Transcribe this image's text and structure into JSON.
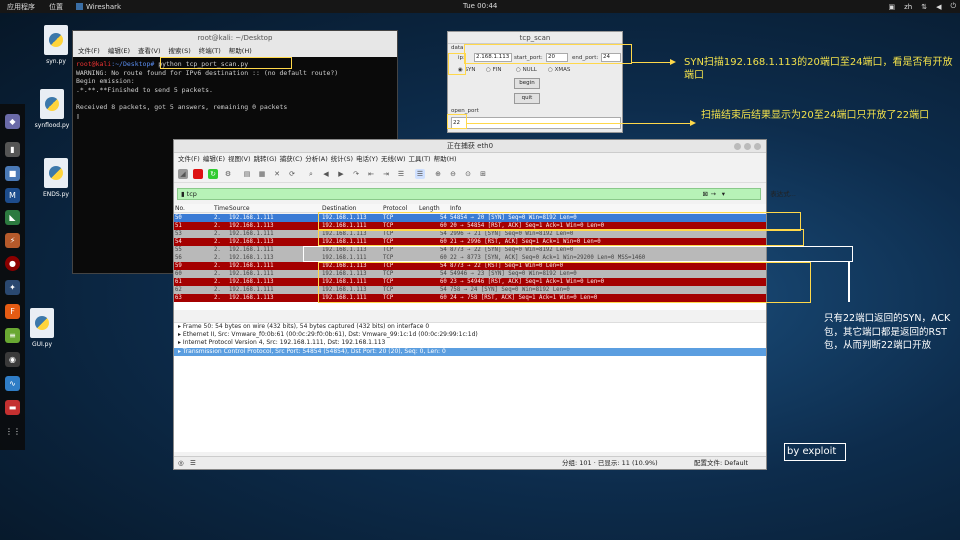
{
  "topbar": {
    "apps": "应用程序",
    "places": "位置",
    "taskbar_app": "Wireshark",
    "clock": "Tue 00:44",
    "lang": "zh"
  },
  "desktop": {
    "icons": [
      {
        "label": "syn.py"
      },
      {
        "label": "synflood.py"
      },
      {
        "label": "ENDS.py"
      },
      {
        "label": "GUI.py"
      }
    ]
  },
  "terminal": {
    "title": "root@kali: ~/Desktop",
    "menu": [
      "文件(F)",
      "编辑(E)",
      "查看(V)",
      "搜索(S)",
      "终端(T)",
      "帮助(H)"
    ],
    "prompt_user": "root@kali",
    "prompt_path": ":~/Desktop#",
    "command": " python tcp_port_scan.py",
    "lines": [
      "WARNING: No route found for IPv6 destination :: (no default route?)",
      "Begin emission:",
      ".*.**.**Finished to send 5 packets.",
      "",
      "Received 8 packets, got 5 answers, remaining 0 packets",
      "▯"
    ]
  },
  "tcp_scan": {
    "title": "tcp_scan",
    "data_label": "data",
    "ip_label": "ip:",
    "ip_value": "2.168.1.113",
    "start_label": "start_port:",
    "start_value": "20",
    "end_label": "end_port:",
    "end_value": "24",
    "modes": [
      "SYN",
      "FIN",
      "NULL",
      "XMAS"
    ],
    "begin": "begin",
    "quit": "quit",
    "open_port_label": "open_port",
    "open_port_value": "22"
  },
  "wireshark": {
    "title": "正在捕获 eth0",
    "menu": [
      "文件(F)",
      "编辑(E)",
      "视图(V)",
      "跳转(G)",
      "捕获(C)",
      "分析(A)",
      "统计(S)",
      "电话(Y)",
      "无线(W)",
      "工具(T)",
      "帮助(H)"
    ],
    "filter": "tcp",
    "expr_button": "表达式...",
    "columns": [
      "No.",
      "Time",
      "Source",
      "Destination",
      "Protocol",
      "Length",
      "Info"
    ],
    "packets": [
      {
        "no": "50",
        "time": "2.",
        "src": "192.168.1.111",
        "dst": "192.168.1.113",
        "proto": "TCP",
        "len": "54",
        "info": "54854 → 20 [SYN] Seq=0 Win=8192 Len=0",
        "style": "blue"
      },
      {
        "no": "51",
        "time": "2.",
        "src": "192.168.1.113",
        "dst": "192.168.1.111",
        "proto": "TCP",
        "len": "60",
        "info": "20 → 54854 [RST, ACK] Seq=1 Ack=1 Win=0 Len=0",
        "style": "dark"
      },
      {
        "no": "53",
        "time": "2.",
        "src": "192.168.1.111",
        "dst": "192.168.1.113",
        "proto": "TCP",
        "len": "54",
        "info": "2996 → 21 [SYN] Seq=0 Win=8192 Len=0",
        "style": "gray"
      },
      {
        "no": "54",
        "time": "2.",
        "src": "192.168.1.113",
        "dst": "192.168.1.111",
        "proto": "TCP",
        "len": "60",
        "info": "21 → 2996 [RST, ACK] Seq=1 Ack=1 Win=0 Len=0",
        "style": "dark"
      },
      {
        "no": "55",
        "time": "2.",
        "src": "192.168.1.111",
        "dst": "192.168.1.113",
        "proto": "TCP",
        "len": "54",
        "info": "8773 → 22 [SYN] Seq=0 Win=8192 Len=0",
        "style": "gray"
      },
      {
        "no": "56",
        "time": "2.",
        "src": "192.168.1.113",
        "dst": "192.168.1.111",
        "proto": "TCP",
        "len": "60",
        "info": "22 → 8773 [SYN, ACK] Seq=0 Ack=1 Win=29200 Len=0 MSS=1460",
        "style": "gray"
      },
      {
        "no": "59",
        "time": "2.",
        "src": "192.168.1.111",
        "dst": "192.168.1.113",
        "proto": "TCP",
        "len": "54",
        "info": "8773 → 22 [RST] Seq=1 Win=0 Len=0",
        "style": "dark"
      },
      {
        "no": "60",
        "time": "2.",
        "src": "192.168.1.111",
        "dst": "192.168.1.113",
        "proto": "TCP",
        "len": "54",
        "info": "54946 → 23 [SYN] Seq=0 Win=8192 Len=0",
        "style": "gray"
      },
      {
        "no": "61",
        "time": "2.",
        "src": "192.168.1.113",
        "dst": "192.168.1.111",
        "proto": "TCP",
        "len": "60",
        "info": "23 → 54946 [RST, ACK] Seq=1 Ack=1 Win=0 Len=0",
        "style": "dark"
      },
      {
        "no": "62",
        "time": "2.",
        "src": "192.168.1.111",
        "dst": "192.168.1.113",
        "proto": "TCP",
        "len": "54",
        "info": "758 → 24 [SYN] Seq=0 Win=8192 Len=0",
        "style": "gray"
      },
      {
        "no": "63",
        "time": "2.",
        "src": "192.168.1.113",
        "dst": "192.168.1.111",
        "proto": "TCP",
        "len": "60",
        "info": "24 → 758 [RST, ACK] Seq=1 Ack=1 Win=0 Len=0",
        "style": "dark"
      }
    ],
    "details": [
      "Frame 50: 54 bytes on wire (432 bits), 54 bytes captured (432 bits) on interface 0",
      "Ethernet II, Src: Vmware_f0:0b:61 (00:0c:29:f0:0b:61), Dst: Vmware_99:1c:1d (00:0c:29:99:1c:1d)",
      "Internet Protocol Version 4, Src: 192.168.1.111, Dst: 192.168.1.113",
      "Transmission Control Protocol, Src Port: 54854 (54854), Dst Port: 20 (20), Seq: 0, Len: 0"
    ],
    "status_groups": "分组: 101 · 已显示: 11 (10.9%)",
    "status_profile": "配置文件: Default"
  },
  "annotations": {
    "syn_scan": "SYN扫描192.168.1.113的20端口至24端口，看是否有开放端口",
    "scan_result": "扫描结束后结果显示为20至24端口只开放了22端口",
    "explain": "只有22端口返回的SYN，ACK包，其它端口都是返回的RST包，从而判断22端口开放",
    "signature": "by exploit"
  }
}
